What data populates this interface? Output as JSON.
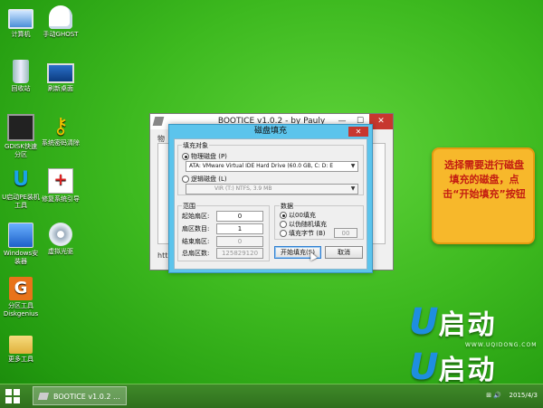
{
  "desktop": {
    "icons": [
      {
        "label": "计算机",
        "icon": "computer-icon"
      },
      {
        "label": "手动GHOST",
        "icon": "ghost-icon"
      },
      {
        "label": "回收站",
        "icon": "recycle-bin-icon"
      },
      {
        "label": "刷新桌面",
        "icon": "refresh-desktop-icon"
      },
      {
        "label": "GDISK快速分区",
        "icon": "gdisk-icon"
      },
      {
        "label": "系统密码清除",
        "icon": "key-icon"
      },
      {
        "label": "U启动PE装机工具",
        "icon": "u-install-icon"
      },
      {
        "label": "修复系统引导",
        "icon": "repair-kit-icon"
      },
      {
        "label": "Windows安装器",
        "icon": "windows-installer-icon"
      },
      {
        "label": "虚拟光驱",
        "icon": "virtual-drive-icon"
      },
      {
        "label": "分区工具Diskgenius",
        "icon": "diskgenius-icon"
      },
      {
        "label": "更多工具",
        "icon": "folder-icon"
      }
    ]
  },
  "bg_window": {
    "title": "BOOTICE v1.0.2 - by Pauly",
    "controls": {
      "minimize": "—",
      "maximize": "☐",
      "close": "✕"
    },
    "tab_partial": "物",
    "footer_partial": "htt"
  },
  "dialog": {
    "title": "磁盘填充",
    "close": "✕",
    "fill_object": {
      "legend": "填充对象",
      "physical_label": "物理磁盘 (P)",
      "physical_value": "ATA: VMware Virtual IDE Hard Drive (60.0 GB, C: D: E",
      "logical_label": "逻辑磁盘 (L)",
      "logical_value": "VIR (T:)   NTFS,   3.9 MB"
    },
    "range": {
      "legend": "范围",
      "start_label": "起始扇区:",
      "start_value": "0",
      "count_label": "扇区数目:",
      "count_value": "1",
      "end_label": "结束扇区:",
      "end_value": "0",
      "total_label": "总扇区数:",
      "total_value": "125829120"
    },
    "data": {
      "legend": "数据",
      "opt_zero": "以00填充",
      "opt_random": "以伪随机填充",
      "opt_byte": "填充字节 (B)",
      "byte_value": "00"
    },
    "buttons": {
      "start": "开始填充(S)",
      "cancel": "取消"
    }
  },
  "callout": {
    "text": "选择需要进行磁盘填充的磁盘，点击“开始填充”按钮"
  },
  "logo": {
    "u": "U",
    "cn": "启动",
    "url": "WWW.UQIDONG.COM"
  },
  "taskbar": {
    "start": "start-icon",
    "task_label": "BOOTICE v1.0.2 ...",
    "tray_icons": "⊞ 🔊",
    "time": "",
    "date": "2015/4/3"
  }
}
